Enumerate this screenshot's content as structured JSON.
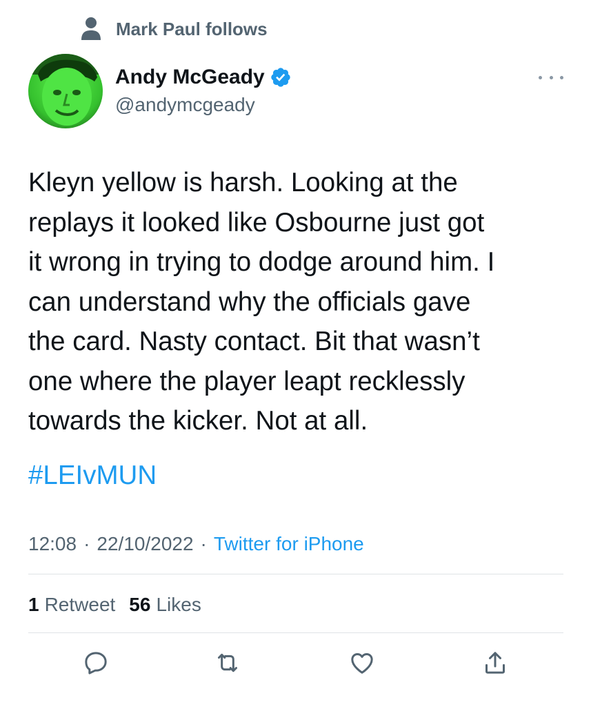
{
  "social_context": {
    "text": "Mark Paul follows",
    "icon": "person-icon"
  },
  "author": {
    "name": "Andy McGeady",
    "handle": "@andymcgeady",
    "verified": true,
    "avatar_icon": "avatar"
  },
  "tweet": {
    "text": "Kleyn yellow is harsh. Looking at the\nreplays it looked like Osbourne just got\nit wrong in trying to dodge around him. I\ncan understand why the officials gave\nthe card. Nasty contact. Bit that wasn’t\none where the player leapt recklessly\ntowards the kicker. Not at all.",
    "hashtag": "#LEIvMUN"
  },
  "meta": {
    "time": "12:08",
    "sep1": "·",
    "date": "22/10/2022",
    "sep2": "·",
    "source": "Twitter for iPhone"
  },
  "stats": {
    "retweet_count": "1",
    "retweet_label": "Retweet",
    "likes_count": "56",
    "likes_label": "Likes"
  },
  "actions": [
    "reply-icon",
    "retweet-icon",
    "like-icon",
    "share-icon"
  ],
  "colors": {
    "accent": "#1d9bf0",
    "secondary_text": "#536471",
    "primary_text": "#0f1419",
    "divider": "#dfe3e6",
    "avatar_green": "#3fd33a"
  }
}
